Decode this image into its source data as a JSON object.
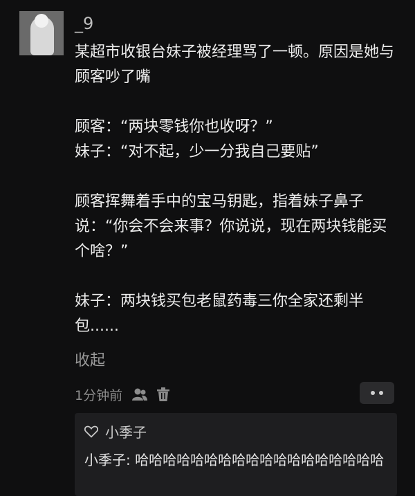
{
  "post": {
    "username": "_9",
    "lines": [
      "某超市收银台妹子被经理骂了一顿。原因是她与顾客吵了嘴",
      "",
      "顾客：“两块零钱你也收呀？”",
      "妹子：“对不起，少一分我自己要贴”",
      "",
      "顾客挥舞着手中的宝马钥匙，指着妹子鼻子说：“你会不会来事？你说说，现在两块钱能买个啥？”",
      "",
      "妹子：两块钱买包老鼠药毒三你全家还剩半包......"
    ],
    "collapse_label": "收起",
    "time": "1分钟前"
  },
  "icons": {
    "avatar": "avatar",
    "friends": "people-icon",
    "delete": "trash-icon",
    "more": "more-dots-icon",
    "like": "heart-outline-icon"
  },
  "comments": {
    "liked_by": "小季子",
    "reply": {
      "author": "小季子",
      "separator": ": ",
      "text": "哈哈哈哈哈哈哈哈哈哈哈哈哈哈哈哈哈哈"
    }
  }
}
